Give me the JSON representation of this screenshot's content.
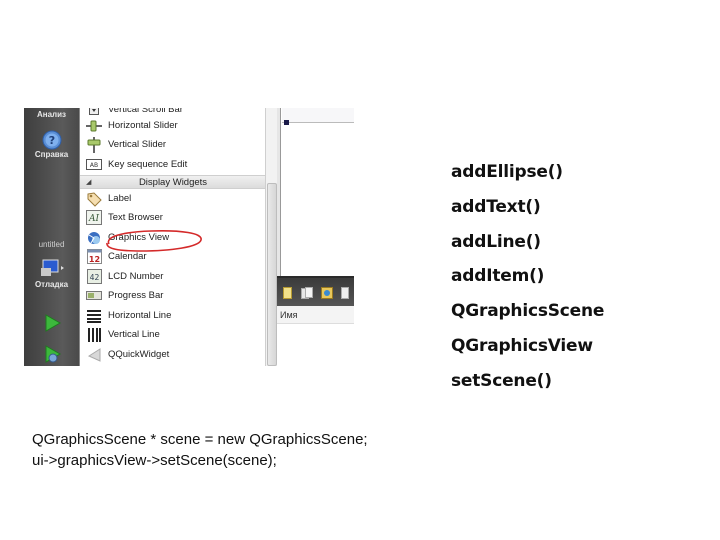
{
  "screenshot": {
    "modebar": {
      "items": [
        {
          "label": "Анализ",
          "icon": "analyze-icon"
        },
        {
          "label": "Справка",
          "icon": "help-icon"
        },
        {
          "label": "untitled",
          "icon": ""
        },
        {
          "label": "Отладка",
          "icon": "debug-monitor-icon"
        },
        {
          "label": "",
          "icon": "run-icon"
        },
        {
          "label": "",
          "icon": "debug-run-icon"
        }
      ]
    },
    "widgetbox": {
      "items_before": [
        {
          "label": "Vertical Scroll Bar",
          "icon": "scrollbar-icon"
        },
        {
          "label": "Horizontal Slider",
          "icon": "horizontal-slider-icon"
        },
        {
          "label": "Vertical Slider",
          "icon": "vertical-slider-icon"
        },
        {
          "label": "Key sequence Edit",
          "icon": "key-sequence-icon"
        }
      ],
      "category": "Display Widgets",
      "items_after": [
        {
          "label": "Label",
          "icon": "label-tag-icon"
        },
        {
          "label": "Text Browser",
          "icon": "text-browser-icon"
        },
        {
          "label": "Graphics View",
          "icon": "graphics-view-icon",
          "highlighted": true
        },
        {
          "label": "Calendar",
          "icon": "calendar-icon",
          "icon_text": "12"
        },
        {
          "label": "LCD Number",
          "icon": "lcd-number-icon"
        },
        {
          "label": "Progress Bar",
          "icon": "progress-bar-icon"
        },
        {
          "label": "Horizontal Line",
          "icon": "horizontal-line-icon"
        },
        {
          "label": "Vertical Line",
          "icon": "vertical-line-icon"
        },
        {
          "label": "QQuickWidget",
          "icon": "quick-widget-icon"
        }
      ]
    },
    "bottom_panel": {
      "header": "Имя"
    },
    "annotation_color": "#d42a2a"
  },
  "api_list": [
    "addEllipse()",
    "addText()",
    "addLine()",
    "addItem()",
    "QGraphicsScene",
    "QGraphicsView",
    "setScene()"
  ],
  "code": [
    "QGraphicsScene * scene = new QGraphicsScene;",
    "ui->graphicsView->setScene(scene);"
  ]
}
